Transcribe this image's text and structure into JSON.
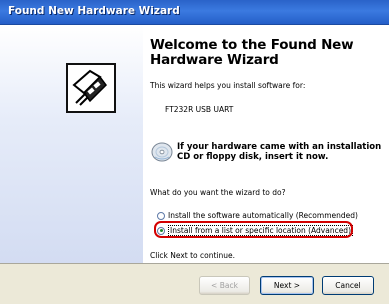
{
  "window": {
    "title": "Found New Hardware Wizard"
  },
  "wizard": {
    "heading": "Welcome to the Found New Hardware Wizard",
    "intro": "This wizard helps you install software for:",
    "device": "FT232R USB UART",
    "cd_prompt": "If your hardware came with an installation CD or floppy disk, insert it now.",
    "question": "What do you want the wizard to do?",
    "options": [
      {
        "label": "Install the software automatically (Recommended)",
        "selected": false
      },
      {
        "label": "Install from a list or specific location (Advanced)",
        "selected": true
      }
    ],
    "continue_hint": "Click Next to continue."
  },
  "buttons": {
    "back": "< Back",
    "next": "Next >",
    "cancel": "Cancel"
  },
  "colors": {
    "highlight": "#d40000",
    "titlebar": "#2a63c9"
  },
  "icons": [
    "hardware-wizard-icon",
    "cd-icon"
  ]
}
